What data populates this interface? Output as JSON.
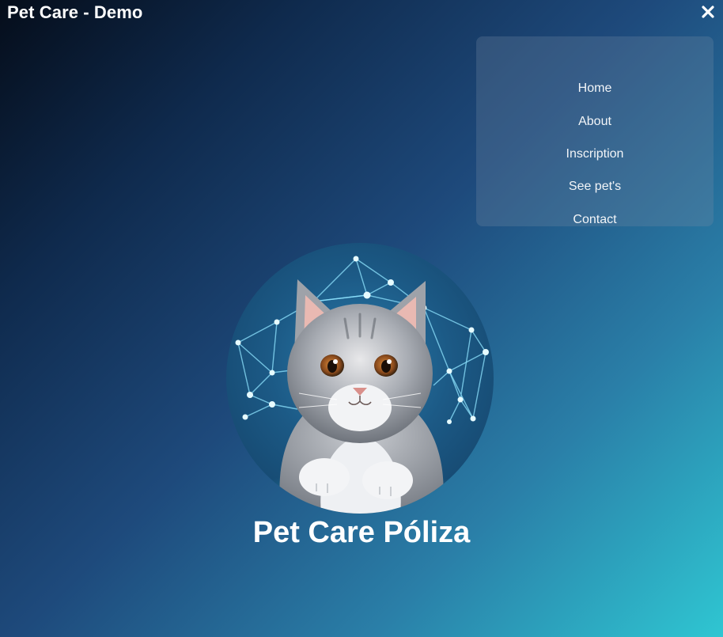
{
  "app": {
    "title": "Pet Care - Demo"
  },
  "menu": {
    "items": [
      {
        "label": "Home"
      },
      {
        "label": "About"
      },
      {
        "label": "Inscription"
      },
      {
        "label": "See pet's"
      },
      {
        "label": "Contact"
      }
    ]
  },
  "hero": {
    "title": "Pet Care Póliza",
    "image_icon": "kitten-network-image"
  },
  "icons": {
    "close": "close-icon"
  },
  "colors": {
    "gradient_start": "#050d1a",
    "gradient_mid": "#1e4a7c",
    "gradient_end": "#2fc6d2",
    "menu_panel": "rgba(120,140,165,0.28)",
    "text": "#ffffff"
  }
}
